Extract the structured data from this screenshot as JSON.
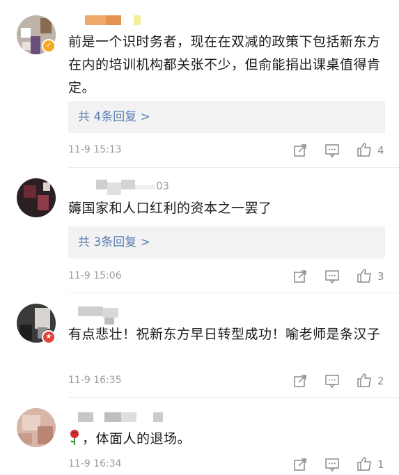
{
  "comments": [
    {
      "text": "前是一个识时务者，现在在双减的政策下包括新东方在内的培训机构都关张不少，但俞能捐出课桌值得肯定。",
      "replies": "共 4条回复 >",
      "time": "11-9 15:13",
      "likes": "4"
    },
    {
      "username_fragment": "03",
      "text": "薅国家和人口红利的资本之一罢了",
      "replies": "共 3条回复 >",
      "time": "11-9 15:06",
      "likes": "3"
    },
    {
      "text": "有点悲壮！祝新东方早日转型成功！喻老师是条汉子",
      "time": "11-9 16:35",
      "likes": "2"
    },
    {
      "text": "，体面人的退场。",
      "time": "11-9 16:34",
      "likes": "1"
    }
  ],
  "icons": {
    "share": "share-icon",
    "comment": "comment-icon",
    "like": "thumbs-up-icon",
    "verified": "verified-badge-icon",
    "rose": "rose-emoji-icon"
  },
  "colors": {
    "link": "#5b7fb3",
    "meta": "#9a9a9a",
    "reply_bg": "#f2f2f2",
    "badge_orange": "#f5a623",
    "badge_red": "#e0433a"
  }
}
